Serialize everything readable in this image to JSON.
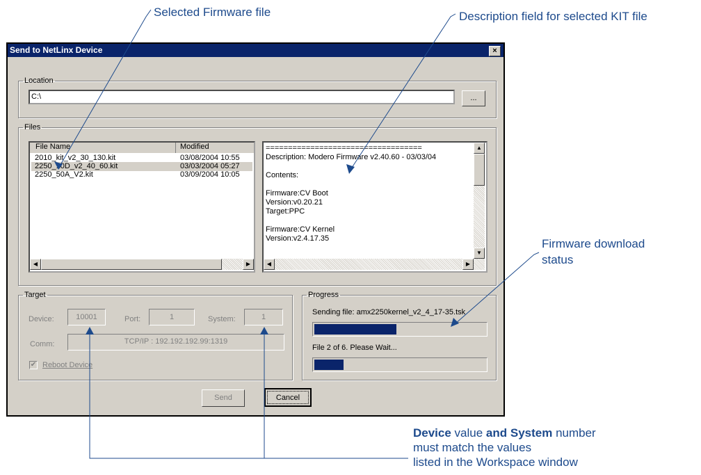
{
  "callouts": {
    "selected_firmware": "Selected Firmware file",
    "description_field": "Description field for selected KIT file",
    "download_status_line1": "Firmware download",
    "download_status_line2": "status",
    "note_device": "Device",
    "note_value_and": " value ",
    "note_and_system": "and System",
    "note_number": " number",
    "note_line2": "must match the values",
    "note_line3": "listed in the Workspace window"
  },
  "dialog": {
    "title": "Send to NetLinx Device",
    "close_glyph": "×",
    "location": {
      "legend": "Location",
      "value": "C:\\",
      "browse_label": "..."
    },
    "files": {
      "legend": "Files",
      "columns": [
        "File Name",
        "Modified"
      ],
      "rows": [
        {
          "name": "2010_kit_v2_30_130.kit",
          "modified": "03/08/2004  10:55"
        },
        {
          "name": "2250_10D_v2_40_60.kit",
          "modified": "03/03/2004  05:27"
        },
        {
          "name": "2250_50A_V2.kit",
          "modified": "03/09/2004  10:05"
        }
      ],
      "selected_index": 1,
      "description_lines": [
        "===================================",
        "Description: Modero Firmware v2.40.60 - 03/03/04",
        "",
        "Contents:",
        "",
        "Firmware:CV Boot",
        "Version:v0.20.21",
        "Target:PPC",
        "",
        "Firmware:CV Kernel",
        "Version:v2.4.17.35"
      ]
    },
    "target": {
      "legend": "Target",
      "device_label": "Device:",
      "device_value": "10001",
      "port_label": "Port:",
      "port_value": "1",
      "system_label": "System:",
      "system_value": "1",
      "comm_label": "Comm:",
      "comm_value": "TCP/IP : 192.192.192.99:1319",
      "reboot_label": "Reboot Device",
      "reboot_checked": true
    },
    "progress": {
      "legend": "Progress",
      "sending_text": "Sending file: amx2250kernel_v2_4_17-35.tsk",
      "file_progress": 0.48,
      "file_count_text": "File 2 of 6. Please Wait...",
      "overall_progress": 0.17
    },
    "buttons": {
      "send": "Send",
      "cancel": "Cancel"
    }
  },
  "colors": {
    "annotation": "#1d4a8c",
    "titlebar": "#0a246a",
    "dialog_bg": "#d4d0c8"
  }
}
